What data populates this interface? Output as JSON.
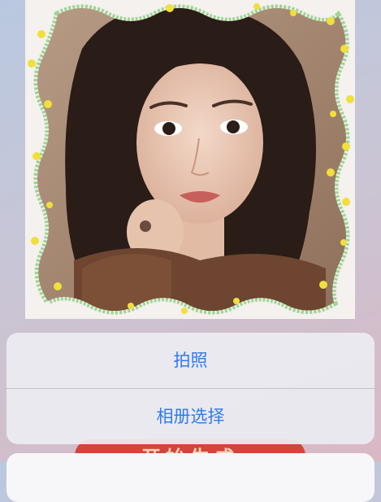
{
  "action_sheet": {
    "options": [
      {
        "label": "拍照"
      },
      {
        "label": "相册选择"
      }
    ],
    "accent_color": "#2f7bf0"
  },
  "background_button": {
    "label": "开始生成",
    "color": "#d1453b"
  },
  "photo": {
    "frame_color": "#9fd494",
    "dot_color": "#f1df3c"
  }
}
